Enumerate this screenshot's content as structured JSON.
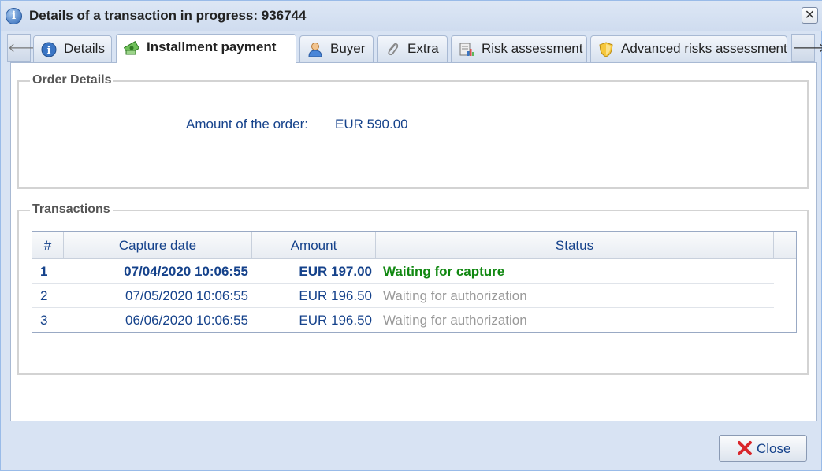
{
  "window": {
    "title": "Details of a transaction in progress: 936744",
    "title_icon": "info-icon",
    "close_icon": "close-x-icon"
  },
  "tabs": [
    {
      "label": "Details",
      "icon": "info-icon",
      "active": false
    },
    {
      "label": "Installment payment",
      "icon": "money-icon",
      "active": true
    },
    {
      "label": "Buyer",
      "icon": "user-icon",
      "active": false
    },
    {
      "label": "Extra",
      "icon": "paperclip-icon",
      "active": false
    },
    {
      "label": "Risk assessment",
      "icon": "report-icon",
      "active": false
    },
    {
      "label": "Advanced risks assessment",
      "icon": "shield-icon",
      "active": false
    }
  ],
  "tab_scroll": {
    "left_icon": "arrow-left-icon",
    "right_icon": "arrow-right-icon"
  },
  "order_details": {
    "legend": "Order Details",
    "amount_label": "Amount of the order:",
    "amount_value": "EUR 590.00"
  },
  "transactions": {
    "legend": "Transactions",
    "columns": [
      "#",
      "Capture date",
      "Amount",
      "Status"
    ],
    "rows": [
      {
        "num": "1",
        "date": "07/04/2020 10:06:55",
        "amount": "EUR 197.00",
        "status": "Waiting for capture",
        "status_color": "#118811",
        "bold": true
      },
      {
        "num": "2",
        "date": "07/05/2020 10:06:55",
        "amount": "EUR 196.50",
        "status": "Waiting for authorization",
        "status_color": "#999999",
        "bold": false
      },
      {
        "num": "3",
        "date": "06/06/2020 10:06:55",
        "amount": "EUR 196.50",
        "status": "Waiting for authorization",
        "status_color": "#999999",
        "bold": false
      }
    ]
  },
  "footer": {
    "close_label": "Close",
    "close_icon": "red-x-icon"
  },
  "colors": {
    "accent": "#15428b",
    "capture_status": "#118811",
    "auth_status": "#999999"
  }
}
